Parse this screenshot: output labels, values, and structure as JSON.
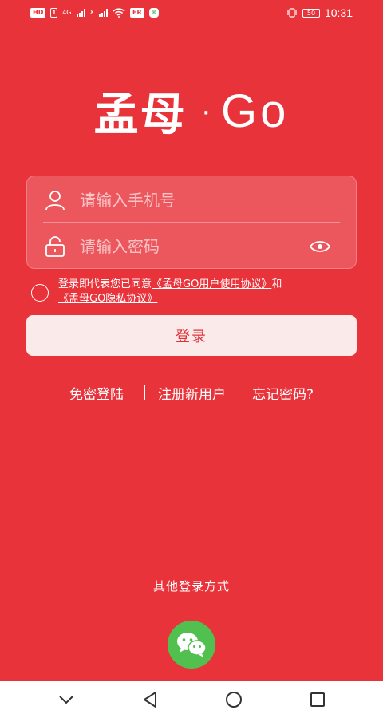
{
  "status_bar": {
    "hd_label": "HD",
    "network_label": "4G",
    "x_label": "X",
    "notif_label": "ER",
    "battery_level": "50",
    "time": "10:31"
  },
  "logo": {
    "cn": "孟母",
    "dot": "·",
    "go": "Go"
  },
  "login": {
    "phone_placeholder": "请输入手机号",
    "password_placeholder": "请输入密码"
  },
  "agreement": {
    "prefix": "登录即代表您已同意",
    "user_agreement": "《孟母GO用户使用协议》",
    "and": "和",
    "privacy": "《孟母GO隐私协议》"
  },
  "login_button": "登录",
  "links": {
    "no_password": "免密登陆",
    "register": "注册新用户",
    "forgot": "忘记密码?"
  },
  "other_login": {
    "label": "其他登录方式"
  },
  "icons": {
    "user": "user-icon",
    "lock": "lock-icon",
    "eye": "eye-icon",
    "wechat": "wechat-icon"
  },
  "colors": {
    "background": "#e8333a",
    "button_bg": "#fbeaea",
    "button_text": "#e0333a",
    "wechat_green": "#52c04f"
  }
}
